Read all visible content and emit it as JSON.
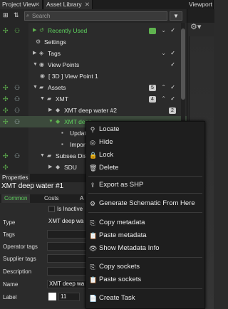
{
  "tabs": {
    "project_view": "Project View",
    "asset_library": "Asset Library",
    "viewport": "Viewport",
    "properties": "Properties"
  },
  "search": {
    "placeholder": "Search"
  },
  "tree": {
    "recently_used": "Recently Used",
    "recently_used_badge": "",
    "settings": "Settings",
    "tags": "Tags",
    "view_points": "View Points",
    "view_point_1": "[ 3D ] View Point 1",
    "assets": "Assets",
    "assets_badge": "5",
    "xmt": "XMT",
    "xmt_badge": "4",
    "xmt_deep_water_2": "XMT deep water #2",
    "xmt_deep_water_2_badge": "2",
    "xmt_deep_water_1": "XMT deep",
    "updates": "Updat",
    "imports": "Import",
    "subsea_dist": "Subsea Dist",
    "sdu": "SDU"
  },
  "properties": {
    "title": "XMT deep water #1",
    "tabs": [
      "Common",
      "Costs",
      "A"
    ],
    "is_inactive": "Is Inactive",
    "labels": {
      "type": "Type",
      "tags": "Tags",
      "operator_tags": "Operator tags",
      "supplier_tags": "Supplier tags",
      "description": "Description",
      "name": "Name",
      "label": "Label"
    },
    "values": {
      "type": "XMT deep wa",
      "name": "XMT deep wa",
      "label_size": "11"
    }
  },
  "context_menu": {
    "items": [
      {
        "icon": "pin-icon",
        "glyph": "⚲",
        "label": "Locate"
      },
      {
        "icon": "eye-slash-icon",
        "glyph": "◎",
        "label": "Hide"
      },
      {
        "icon": "lock-icon",
        "glyph": "🔒",
        "label": "Lock"
      },
      {
        "icon": "trash-icon",
        "glyph": "🗑",
        "label": "Delete"
      },
      {
        "icon": "export-icon",
        "glyph": "⇪",
        "label": "Export as SHP"
      },
      {
        "icon": "schematic-icon",
        "glyph": "⚙",
        "label": "Generate Schematic From Here"
      },
      {
        "icon": "copy-icon",
        "glyph": "⎘",
        "label": "Copy metadata"
      },
      {
        "icon": "paste-icon",
        "glyph": "📋",
        "label": "Paste metadata"
      },
      {
        "icon": "eye-icon",
        "glyph": "👁",
        "label": "Show Metadata Info"
      },
      {
        "icon": "copy-sockets-icon",
        "glyph": "⎘",
        "label": "Copy sockets"
      },
      {
        "icon": "paste-sockets-icon",
        "glyph": "📋",
        "label": "Paste sockets"
      },
      {
        "icon": "task-icon",
        "glyph": "📄",
        "label": "Create Task"
      }
    ]
  },
  "colors": {
    "accent_green": "#5fb34f",
    "background": "#2b2b2b",
    "menu_bg": "#1e1e1e"
  }
}
